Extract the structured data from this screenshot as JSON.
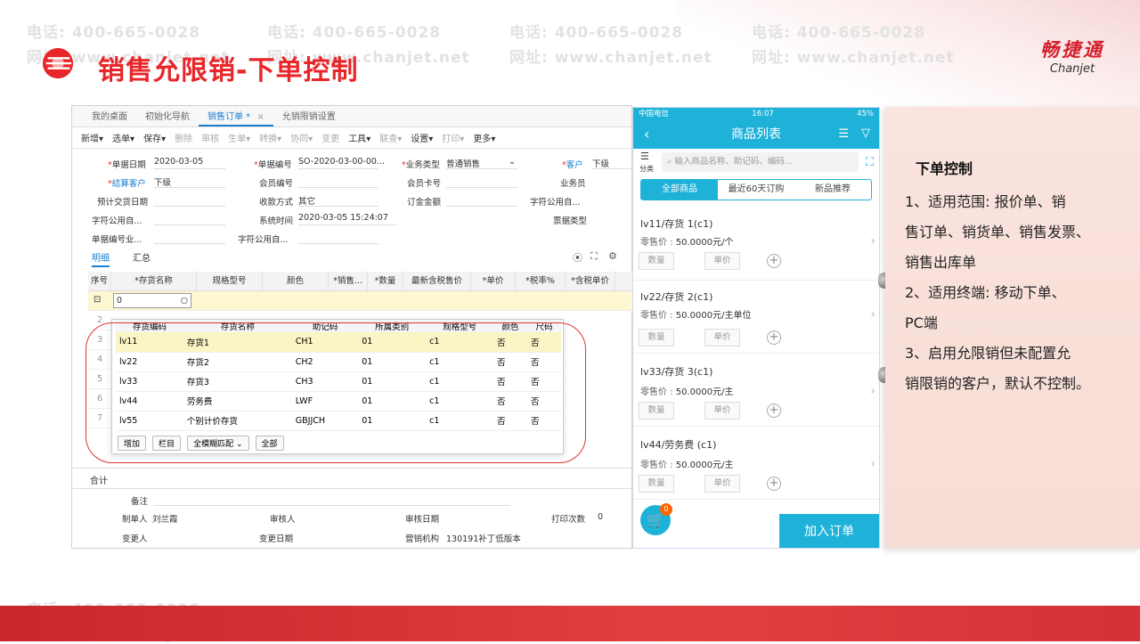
{
  "slide": {
    "title": "销售允限销-下单控制",
    "brand_cn": "畅捷通",
    "brand_en": "Chanjet"
  },
  "watermark": {
    "phone": "电话: 400-665-0028",
    "site": "网址: www.chanjet.net"
  },
  "desktop": {
    "tabs": [
      "我的桌面",
      "初始化导航",
      "销售订单 *",
      "允销限销设置"
    ],
    "toolbar": [
      "新增",
      "选单",
      "保存",
      "删除",
      "审核",
      "生单",
      "转换",
      "协同",
      "变更",
      "工具",
      "联查",
      "设置",
      "打印",
      "更多"
    ],
    "form": {
      "date_label": "单据日期",
      "date_value": "2020-03-05",
      "no_label": "单据编号",
      "no_value": "SO-2020-03-00-00...",
      "biztype_label": "业务类型",
      "biztype_value": "普通销售",
      "customer_label": "客户",
      "customer_value": "下级",
      "settle_label": "结算客户",
      "settle_value": "下级",
      "member_label": "会员编号",
      "card_label": "会员卡号",
      "sales_label": "业务员",
      "delivery_label": "预计交货日期",
      "pay_label": "收款方式",
      "pay_value": "其它",
      "deposit_label": "订金金额",
      "custom1_label": "字符公用自...",
      "custom2_label": "字符公用自...",
      "systime_label": "系统时间",
      "systime_value": "2020-03-05 15:24:07",
      "invoice_label": "票据类型",
      "billno_label": "单据编号业...",
      "custom3_label": "字符公用自..."
    },
    "subtabs": [
      "明细",
      "汇总"
    ],
    "grid_headers": [
      "序号",
      "*存货名称",
      "规格型号",
      "颜色",
      "*销售...",
      "*数量",
      "最新含税售价",
      "*单价",
      "*税率%",
      "*含税单价"
    ],
    "grid_input_value": "0",
    "row_numbers": [
      "1",
      "2",
      "3",
      "4",
      "5",
      "6",
      "7"
    ],
    "total_label": "合计",
    "footer": {
      "remark_label": "备注",
      "maker_label": "制单人",
      "maker_value": "刘兰霞",
      "auditor_label": "审核人",
      "auditdate_label": "审核日期",
      "printcount_label": "打印次数",
      "printcount_value": "0",
      "changer_label": "变更人",
      "changedate_label": "变更日期",
      "org_label": "营销机构",
      "org_value": "130191补丁低版本"
    },
    "popup": {
      "headers": [
        "存货编码",
        "存货名称",
        "助记码",
        "所属类别",
        "规格型号",
        "颜色",
        "尺码"
      ],
      "rows": [
        [
          "lv11",
          "存货1",
          "CH1",
          "01",
          "c1",
          "否",
          "否"
        ],
        [
          "lv22",
          "存货2",
          "CH2",
          "01",
          "c1",
          "否",
          "否"
        ],
        [
          "lv33",
          "存货3",
          "CH3",
          "01",
          "c1",
          "否",
          "否"
        ],
        [
          "lv44",
          "劳务费",
          "LWF",
          "01",
          "c1",
          "否",
          "否"
        ],
        [
          "lv55",
          "个别计价存货",
          "GBJJCH",
          "01",
          "c1",
          "否",
          "否"
        ]
      ],
      "btn_add": "增加",
      "btn_col": "栏目",
      "match_select": "全模糊匹配",
      "btn_all": "全部"
    }
  },
  "mobile": {
    "carrier": "中国电信",
    "time": "16:07",
    "battery": "45%",
    "title": "商品列表",
    "category_label": "分类",
    "search_placeholder": "输入商品名称、助记码、编码...",
    "segments": [
      "全部商品",
      "最近60天订购",
      "新品推荐"
    ],
    "price_label": "零售价 :",
    "qty_label": "数量",
    "unit_price_label": "单价",
    "products": [
      {
        "name": "lv11/存货 1(c1)",
        "price": "50.0000元/个"
      },
      {
        "name": "lv22/存货 2(c1)",
        "price": "50.0000元/主单位"
      },
      {
        "name": "lv33/存货 3(c1)",
        "price": "50.0000元/主"
      },
      {
        "name": "lv44/劳务费 (c1)",
        "price": "50.0000元/主"
      }
    ],
    "cart_count": "0",
    "add_order": "加入订单"
  },
  "note": {
    "heading": "下单控制",
    "lines": [
      "1、适用范围: 报价单、销",
      "售订单、销货单、销售发票、",
      "销售出库单",
      "2、适用终端: 移动下单、",
      "PC端",
      "3、启用允限销但未配置允",
      "销限销的客户，默认不控制。"
    ]
  }
}
